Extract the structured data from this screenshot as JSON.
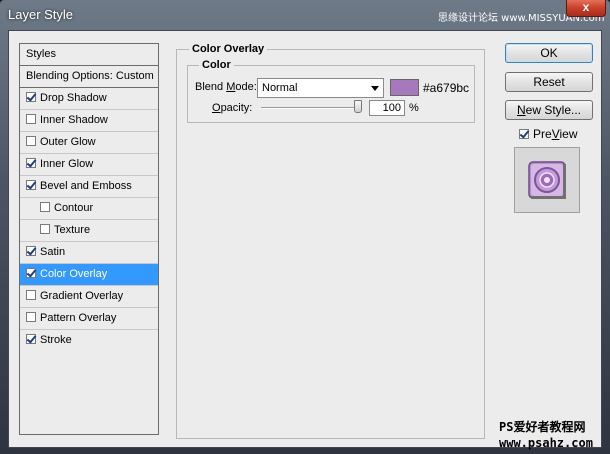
{
  "window": {
    "title": "Layer Style",
    "watermark_top": "思缘设计论坛 www.MISSYUAN.com",
    "close_label": "x"
  },
  "styles_list": {
    "header": "Styles",
    "blending_options": "Blending Options: Custom",
    "items": [
      {
        "label": "Drop Shadow",
        "checked": true
      },
      {
        "label": "Inner Shadow",
        "checked": false
      },
      {
        "label": "Outer Glow",
        "checked": false
      },
      {
        "label": "Inner Glow",
        "checked": true
      },
      {
        "label": "Bevel and Emboss",
        "checked": true
      },
      {
        "label": "Contour",
        "checked": false
      },
      {
        "label": "Texture",
        "checked": false
      },
      {
        "label": "Satin",
        "checked": true
      },
      {
        "label": "Color Overlay",
        "checked": true,
        "selected": true
      },
      {
        "label": "Gradient Overlay",
        "checked": false
      },
      {
        "label": "Pattern Overlay",
        "checked": false
      },
      {
        "label": "Stroke",
        "checked": true
      }
    ]
  },
  "color_overlay": {
    "group_title": "Color Overlay",
    "sub_title": "Color",
    "blend_mode_label_pre": "Blend ",
    "blend_mode_label_u": "M",
    "blend_mode_label_post": "ode:",
    "blend_mode_value": "Normal",
    "color_swatch": "#a679bc",
    "color_hex_text": "#a679bc",
    "opacity_label_u": "O",
    "opacity_label_post": "pacity:",
    "opacity_value": "100",
    "opacity_level": 1.0,
    "opacity_unit": "%"
  },
  "buttons": {
    "ok": "OK",
    "reset": "Reset",
    "new_style_u": "N",
    "new_style_rest": "ew Style..."
  },
  "preview": {
    "checked": true,
    "label_u": "V",
    "label_pre": "Pre",
    "label_post": "iew"
  },
  "watermark_bottom": {
    "line1": "PS爱好者教程网",
    "line2": "www.psahz.com"
  },
  "colors": {
    "selection": "#3399ff",
    "overlay": "#a679bc"
  }
}
